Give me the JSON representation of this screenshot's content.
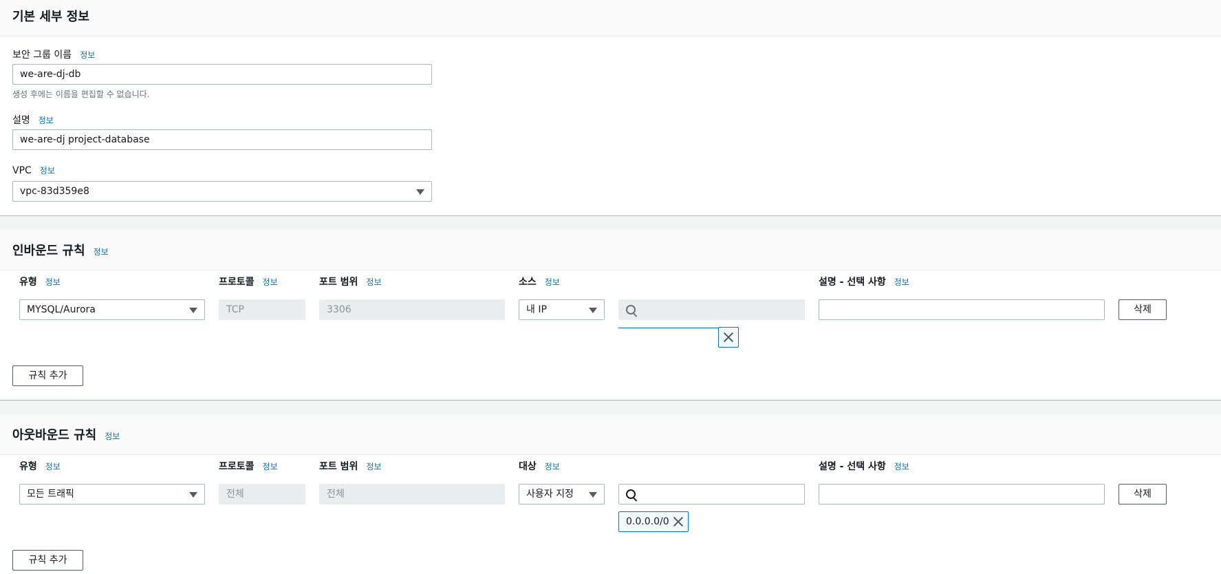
{
  "basic": {
    "title": "기본 세부 정보",
    "name_label": "보안 그룹 이름",
    "name_value": "we-are-dj-db",
    "name_hint": "생성 후에는 이름을 편집할 수 없습니다.",
    "desc_label": "설명",
    "desc_value": "we-are-dj project-database",
    "vpc_label": "VPC",
    "vpc_value": "vpc-83d359e8"
  },
  "info_link": "정보",
  "inbound": {
    "title": "인바운드 규칙",
    "col_type": "유형",
    "col_protocol": "프로토콜",
    "col_port": "포트 범위",
    "col_source": "소스",
    "col_desc": "설명 - 선택 사항",
    "rule": {
      "type": "MYSQL/Aurora",
      "protocol": "TCP",
      "port": "3306",
      "source": "내 IP",
      "search_value": "",
      "desc_value": ""
    },
    "delete_label": "삭제",
    "add_label": "규칙 추가"
  },
  "outbound": {
    "title": "아웃바운드 규칙",
    "col_type": "유형",
    "col_protocol": "프로토콜",
    "col_port": "포트 범위",
    "col_dest": "대상",
    "col_desc": "설명 - 선택 사항",
    "rule": {
      "type": "모든 트래픽",
      "protocol": "전체",
      "port": "전체",
      "dest": "사용자 지정",
      "search_value": "",
      "token": "0.0.0.0/0",
      "desc_value": ""
    },
    "delete_label": "삭제",
    "add_label": "규칙 추가"
  },
  "colors": {
    "link": "#0073bb",
    "border": "#aab7b8",
    "disabled_bg": "#eaeded"
  }
}
